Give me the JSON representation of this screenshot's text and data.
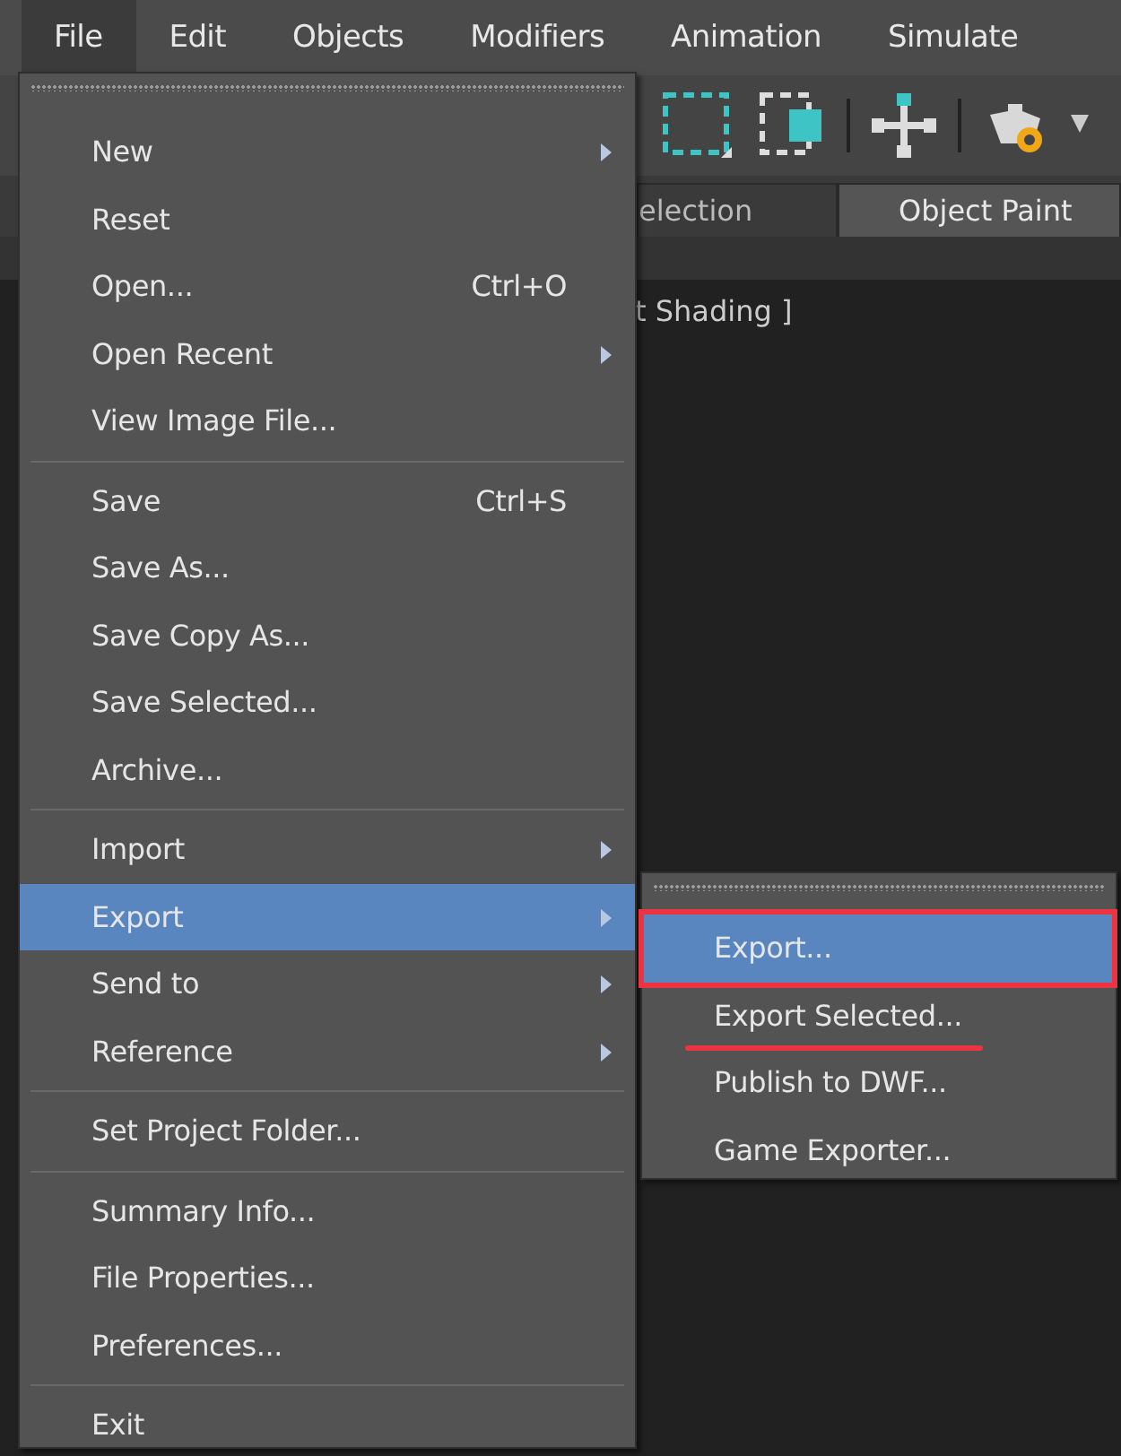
{
  "menubar": [
    {
      "label": "File",
      "selected": true
    },
    {
      "label": "Edit",
      "selected": false
    },
    {
      "label": "Objects",
      "selected": false
    },
    {
      "label": "Modifiers",
      "selected": false
    },
    {
      "label": "Animation",
      "selected": false
    },
    {
      "label": "Simulate",
      "selected": false
    }
  ],
  "tabs": [
    {
      "label": "election",
      "selected": false
    },
    {
      "label": "Object Paint",
      "selected": true
    }
  ],
  "viewport": {
    "label": "t Shading ]"
  },
  "file_menu": {
    "items": [
      {
        "kind": "item",
        "label": "New",
        "submenu": true,
        "highlighted": false
      },
      {
        "kind": "item",
        "label": "Reset",
        "submenu": false,
        "highlighted": false
      },
      {
        "kind": "item",
        "label": "Open...",
        "shortcut": "Ctrl+O",
        "submenu": false,
        "highlighted": false
      },
      {
        "kind": "item",
        "label": "Open Recent",
        "submenu": true,
        "highlighted": false
      },
      {
        "kind": "item",
        "label": "View Image File...",
        "submenu": false,
        "highlighted": false
      },
      {
        "kind": "separator"
      },
      {
        "kind": "item",
        "label": "Save",
        "shortcut": "Ctrl+S",
        "submenu": false,
        "highlighted": false
      },
      {
        "kind": "item",
        "label": "Save As...",
        "submenu": false,
        "highlighted": false
      },
      {
        "kind": "item",
        "label": "Save Copy As...",
        "submenu": false,
        "highlighted": false
      },
      {
        "kind": "item",
        "label": "Save Selected...",
        "submenu": false,
        "highlighted": false
      },
      {
        "kind": "item",
        "label": "Archive...",
        "submenu": false,
        "highlighted": false
      },
      {
        "kind": "separator"
      },
      {
        "kind": "item",
        "label": "Import",
        "submenu": true,
        "highlighted": false
      },
      {
        "kind": "item",
        "label": "Export",
        "submenu": true,
        "highlighted": true
      },
      {
        "kind": "item",
        "label": "Send to",
        "submenu": true,
        "highlighted": false
      },
      {
        "kind": "item",
        "label": "Reference",
        "submenu": true,
        "highlighted": false
      },
      {
        "kind": "separator"
      },
      {
        "kind": "item",
        "label": "Set Project Folder...",
        "submenu": false,
        "highlighted": false
      },
      {
        "kind": "separator"
      },
      {
        "kind": "item",
        "label": "Summary Info...",
        "submenu": false,
        "highlighted": false
      },
      {
        "kind": "item",
        "label": "File Properties...",
        "submenu": false,
        "highlighted": false
      },
      {
        "kind": "item",
        "label": "Preferences...",
        "submenu": false,
        "highlighted": false
      },
      {
        "kind": "separator"
      },
      {
        "kind": "item",
        "label": "Exit",
        "submenu": false,
        "highlighted": false
      }
    ]
  },
  "export_submenu": {
    "items": [
      {
        "kind": "item",
        "label": "Export...",
        "highlighted": true,
        "framed": true,
        "underlined": false
      },
      {
        "kind": "item",
        "label": "Export Selected...",
        "highlighted": false,
        "framed": false,
        "underlined": true
      },
      {
        "kind": "item",
        "label": "Publish to DWF...",
        "highlighted": false,
        "framed": false,
        "underlined": false
      },
      {
        "kind": "item",
        "label": "Game Exporter...",
        "highlighted": false,
        "framed": false,
        "underlined": false
      }
    ]
  }
}
